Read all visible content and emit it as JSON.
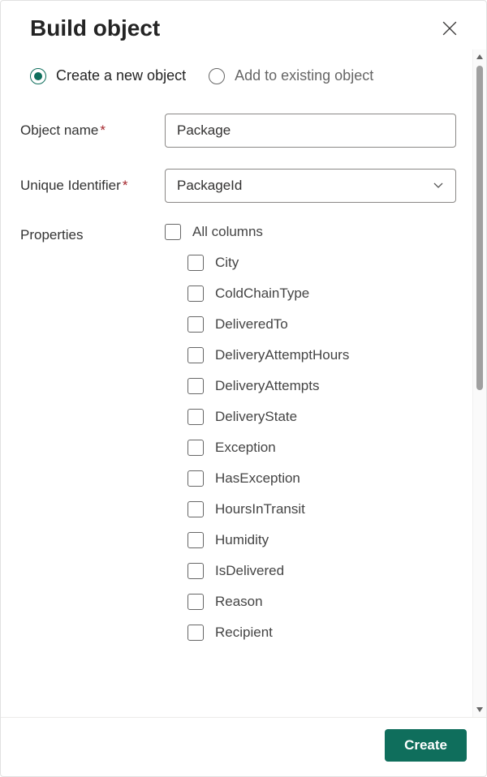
{
  "header": {
    "title": "Build object"
  },
  "mode": {
    "options": [
      {
        "label": "Create a new object",
        "selected": true
      },
      {
        "label": "Add to existing object",
        "selected": false
      }
    ]
  },
  "fields": {
    "object_name": {
      "label": "Object name",
      "required_mark": "*",
      "value": "Package"
    },
    "unique_identifier": {
      "label": "Unique Identifier",
      "required_mark": "*",
      "value": "PackageId"
    },
    "properties": {
      "label": "Properties",
      "all_columns_label": "All columns",
      "items": [
        "City",
        "ColdChainType",
        "DeliveredTo",
        "DeliveryAttemptHours",
        "DeliveryAttempts",
        "DeliveryState",
        "Exception",
        "HasException",
        "HoursInTransit",
        "Humidity",
        "IsDelivered",
        "Reason",
        "Recipient"
      ]
    }
  },
  "footer": {
    "create_label": "Create"
  }
}
